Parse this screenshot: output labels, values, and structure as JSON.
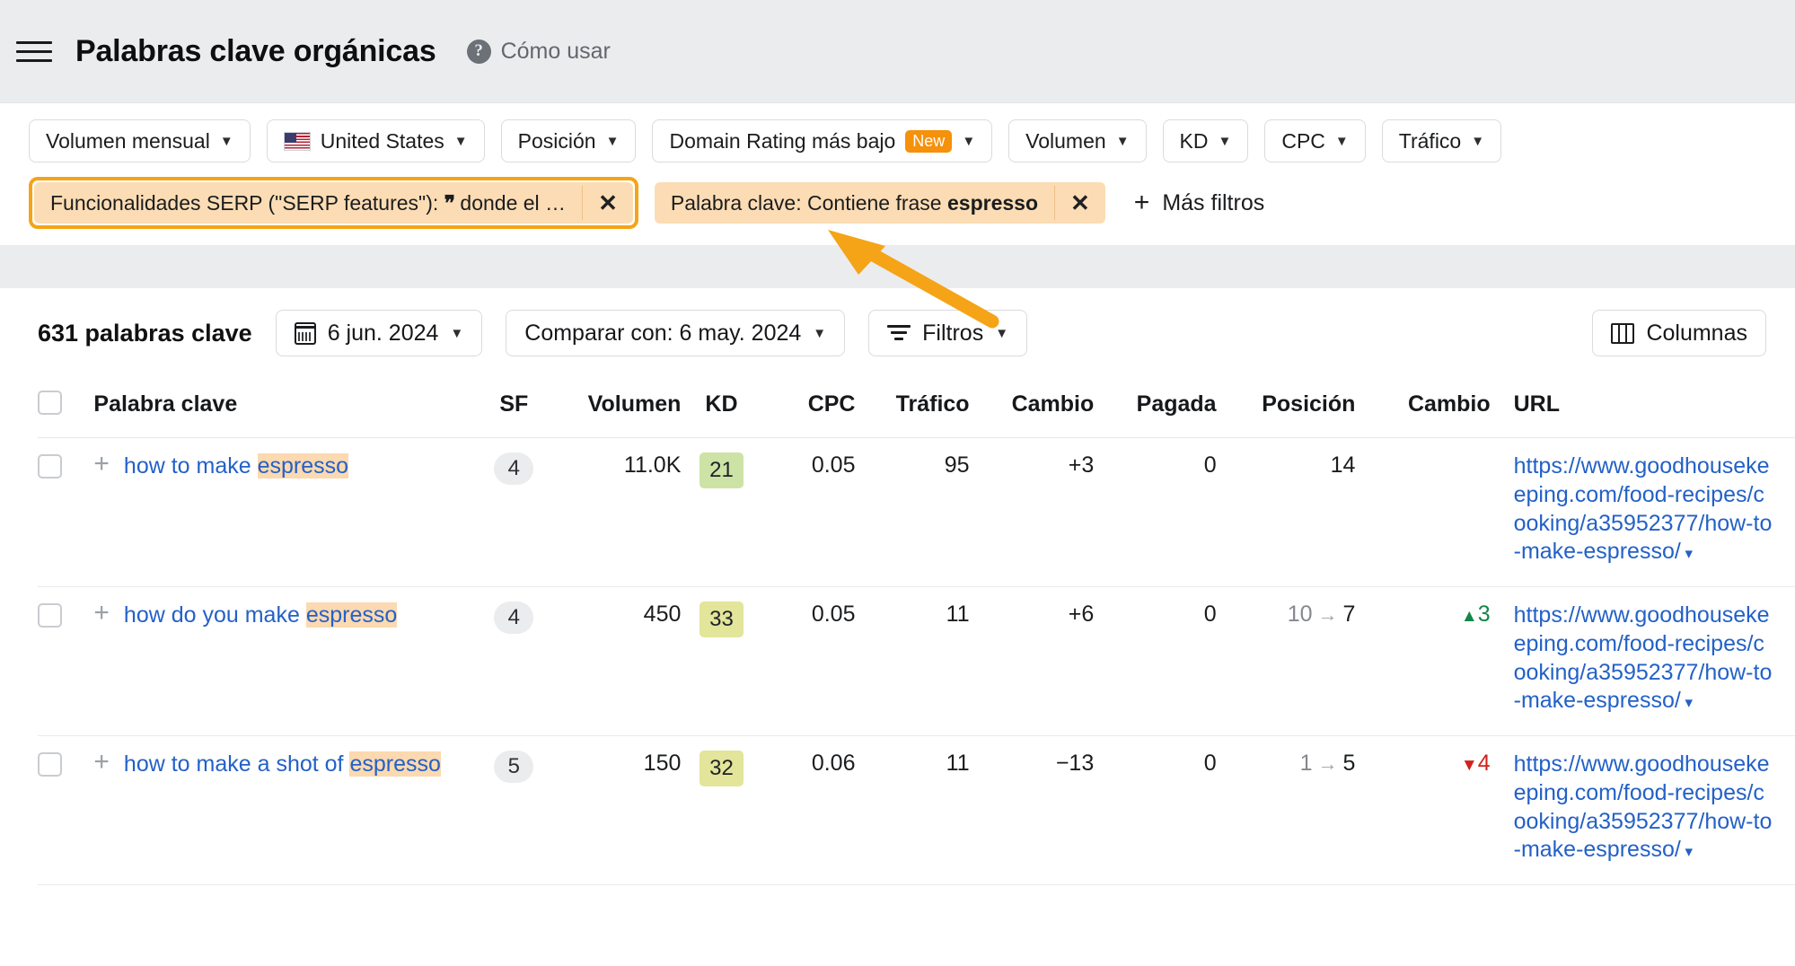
{
  "header": {
    "menu_icon": "hamburger-menu-icon",
    "title": "Palabras clave orgánicas",
    "help_icon": "question-mark-icon",
    "help_label": "Cómo usar"
  },
  "filters": {
    "dropdowns": [
      {
        "label": "Volumen mensual",
        "icon": null,
        "badge": null
      },
      {
        "label": "United States",
        "icon": "us-flag-icon",
        "badge": null
      },
      {
        "label": "Posición",
        "icon": null,
        "badge": null
      },
      {
        "label": "Domain Rating más bajo",
        "icon": null,
        "badge": "New"
      },
      {
        "label": "Volumen",
        "icon": null,
        "badge": null
      },
      {
        "label": "KD",
        "icon": null,
        "badge": null
      },
      {
        "label": "CPC",
        "icon": null,
        "badge": null
      },
      {
        "label": "Tráfico",
        "icon": null,
        "badge": null
      }
    ],
    "chips": [
      {
        "prefix": "Funcionalidades SERP (\"SERP features\"): ",
        "quote_glyph": "❞",
        "suffix": " donde el …",
        "bold": "",
        "close": "✕",
        "highlighted": true
      },
      {
        "prefix": "Palabra clave: Contiene frase ",
        "quote_glyph": "",
        "suffix": "",
        "bold": "espresso",
        "close": "✕",
        "highlighted": false
      }
    ],
    "more_filters_label": "Más filtros",
    "more_filters_icon": "plus-icon",
    "highlight_color": "#f5a417",
    "chip_bg": "#fcdcb4",
    "badge_color": "#f5910a"
  },
  "toolbar": {
    "keyword_count": "631 palabras clave",
    "date_label": "6 jun. 2024",
    "date_icon": "calendar-icon",
    "compare_label": "Comparar con: 6 may. 2024",
    "filters_label": "Filtros",
    "filters_icon": "filter-icon",
    "columns_label": "Columnas",
    "columns_icon": "columns-icon"
  },
  "table": {
    "columns": [
      "Palabra clave",
      "SF",
      "Volumen",
      "KD",
      "CPC",
      "Tráfico",
      "Cambio",
      "Pagada",
      "Posición",
      "Cambio",
      "URL"
    ],
    "rows": [
      {
        "keyword_plain": "how to make ",
        "keyword_highlight": "espresso",
        "keyword_tail": "",
        "sf": "4",
        "volumen": "11.0K",
        "kd": "21",
        "kd_tone": "green",
        "cpc": "0.05",
        "trafico": "95",
        "cambio": "+3",
        "cambio_tone": "up",
        "pagada": "0",
        "pos_old": "",
        "pos_arrow": "",
        "pos_new": "14",
        "pos_cambio": "",
        "pos_cambio_tone": "none",
        "url_lines": [
          "https://www.goodhouseke",
          "eping.com/food-recipes/c",
          "ooking/a35952377/how-to",
          "-make-espresso/"
        ],
        "url_caret": "▾"
      },
      {
        "keyword_plain": "how do you make ",
        "keyword_highlight": "espresso",
        "keyword_tail": "",
        "sf": "4",
        "volumen": "450",
        "kd": "33",
        "kd_tone": "yellow",
        "cpc": "0.05",
        "trafico": "11",
        "cambio": "+6",
        "cambio_tone": "up",
        "pagada": "0",
        "pos_old": "10",
        "pos_arrow": "→",
        "pos_new": "7",
        "pos_cambio": "3",
        "pos_cambio_tone": "up",
        "url_lines": [
          "https://www.goodhouseke",
          "eping.com/food-recipes/c",
          "ooking/a35952377/how-to",
          "-make-espresso/"
        ],
        "url_caret": "▾"
      },
      {
        "keyword_plain": "how to make a shot of ",
        "keyword_highlight": "espresso",
        "keyword_tail": "",
        "sf": "5",
        "volumen": "150",
        "kd": "32",
        "kd_tone": "yellow",
        "cpc": "0.06",
        "trafico": "11",
        "cambio": "−13",
        "cambio_tone": "down",
        "pagada": "0",
        "pos_old": "1",
        "pos_arrow": "→",
        "pos_new": "5",
        "pos_cambio": "4",
        "pos_cambio_tone": "down",
        "url_lines": [
          "https://www.goodhouseke",
          "eping.com/food-recipes/c",
          "ooking/a35952377/how-to",
          "-make-espresso/"
        ],
        "url_caret": "▾"
      }
    ]
  },
  "annotation": {
    "arrow_icon": "arrow-pointer-icon",
    "arrow_color": "#f5a417",
    "points_to": "serp-features-filter-chip"
  },
  "colors": {
    "page_bg": "#ebecee",
    "link": "#2361c7",
    "positive": "#14864a",
    "negative": "#d0211c",
    "highlight": "#fcd9b0"
  }
}
